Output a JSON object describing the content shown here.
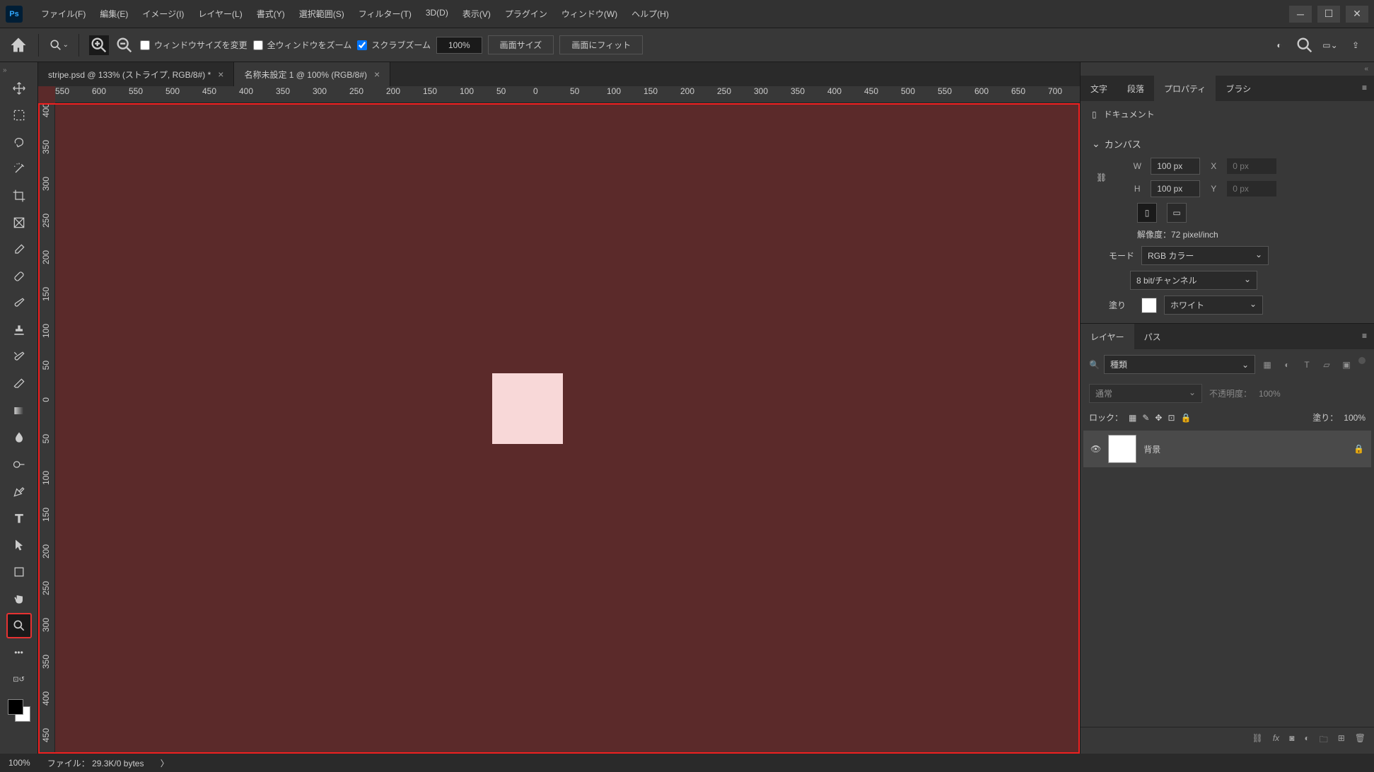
{
  "menu": [
    "ファイル(F)",
    "編集(E)",
    "イメージ(I)",
    "レイヤー(L)",
    "書式(Y)",
    "選択範囲(S)",
    "フィルター(T)",
    "3D(D)",
    "表示(V)",
    "プラグイン",
    "ウィンドウ(W)",
    "ヘルプ(H)"
  ],
  "optbar": {
    "resize_window": "ウィンドウサイズを変更",
    "zoom_all": "全ウィンドウをズーム",
    "scrub_zoom": "スクラブズーム",
    "zoom_value": "100%",
    "actual_size": "画面サイズ",
    "fit_screen": "画面にフィット"
  },
  "tabs": [
    {
      "label": "stripe.psd @ 133% (ストライプ, RGB/8#) *",
      "active": false
    },
    {
      "label": "名称未設定 1 @ 100% (RGB/8#)",
      "active": true
    }
  ],
  "ruler_h": [
    "550",
    "600",
    "550",
    "500",
    "450",
    "400",
    "350",
    "300",
    "250",
    "200",
    "150",
    "100",
    "50",
    "0",
    "50",
    "100",
    "150",
    "200",
    "250",
    "300",
    "350",
    "400",
    "450",
    "500",
    "550",
    "600",
    "650",
    "700"
  ],
  "ruler_v": [
    "400",
    "350",
    "300",
    "250",
    "200",
    "150",
    "100",
    "50",
    "0",
    "50",
    "100",
    "150",
    "200",
    "250",
    "300",
    "350",
    "400",
    "450"
  ],
  "properties": {
    "tabs": [
      "文字",
      "段落",
      "プロパティ",
      "ブラシ"
    ],
    "title": "ドキュメント",
    "canvas_section": "カンバス",
    "w_label": "W",
    "w_value": "100 px",
    "h_label": "H",
    "h_value": "100 px",
    "x_label": "X",
    "x_value": "0 px",
    "y_label": "Y",
    "y_value": "0 px",
    "resolution": "解像度：72 pixel/inch",
    "mode_label": "モード",
    "mode_value": "RGB カラー",
    "bit_value": "8 bit/チャンネル",
    "fill_label": "塗り",
    "fill_value": "ホワイト"
  },
  "layers": {
    "tabs": [
      "レイヤー",
      "パス"
    ],
    "search": "種類",
    "blend_mode": "通常",
    "opacity_label": "不透明度：",
    "opacity_value": "100%",
    "lock_label": "ロック：",
    "fill_label": "塗り：",
    "fill_value": "100%",
    "layer_name": "背景"
  },
  "status": {
    "zoom": "100%",
    "file_label": "ファイル：",
    "file_info": "29.3K/0 bytes"
  }
}
